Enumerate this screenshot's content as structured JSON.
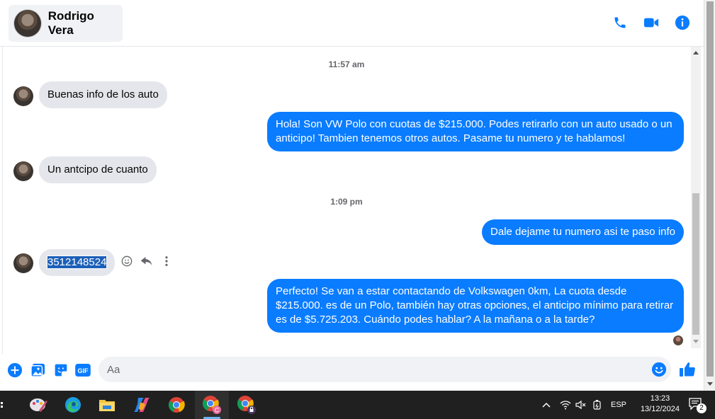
{
  "header": {
    "contact_name": "Rodrigo Vera",
    "actions": [
      "phone-icon",
      "video-icon",
      "info-icon"
    ],
    "accent": "#0a7cff"
  },
  "thread": {
    "timestamps": [
      "11:57 am",
      "1:09 pm"
    ],
    "messages": [
      {
        "from": "contact",
        "text": "Buenas info de los auto"
      },
      {
        "from": "me",
        "text": "Hola! Son VW Polo con cuotas de $215.000. Podes retirarlo con un auto usado o un anticipo! Tambien tenemos otros autos. Pasame tu numero y te hablamos!"
      },
      {
        "from": "contact",
        "text": "Un antcipo de cuanto"
      },
      {
        "from": "me",
        "text": "Dale dejame tu numero asi te paso info"
      },
      {
        "from": "contact",
        "text": "3512148524"
      },
      {
        "from": "me",
        "text": "Perfecto!  Se van a estar contactando de Volkswagen 0km, La cuota desde $215.000. es de un Polo, también hay otras opciones, el anticipo mínimo para retirar es de $5.725.203. Cuándo podes hablar? A la mañana o a la tarde?"
      }
    ],
    "hover_actions": [
      "smiley-icon",
      "reply-icon",
      "more-icon"
    ]
  },
  "composer": {
    "placeholder": "Aa",
    "value": "",
    "buttons": [
      "plus-icon",
      "photo-icon",
      "sticker-icon",
      "gif-icon"
    ],
    "gif_label": "GIF"
  },
  "taskbar": {
    "apps": [
      "task-view",
      "paint",
      "edge",
      "file-explorer",
      "copilot",
      "chrome",
      "chrome-profile-c",
      "chrome-profile-lock"
    ],
    "language": "ESP",
    "time": "13:23",
    "date": "13/12/2024",
    "notification_count": "2"
  }
}
